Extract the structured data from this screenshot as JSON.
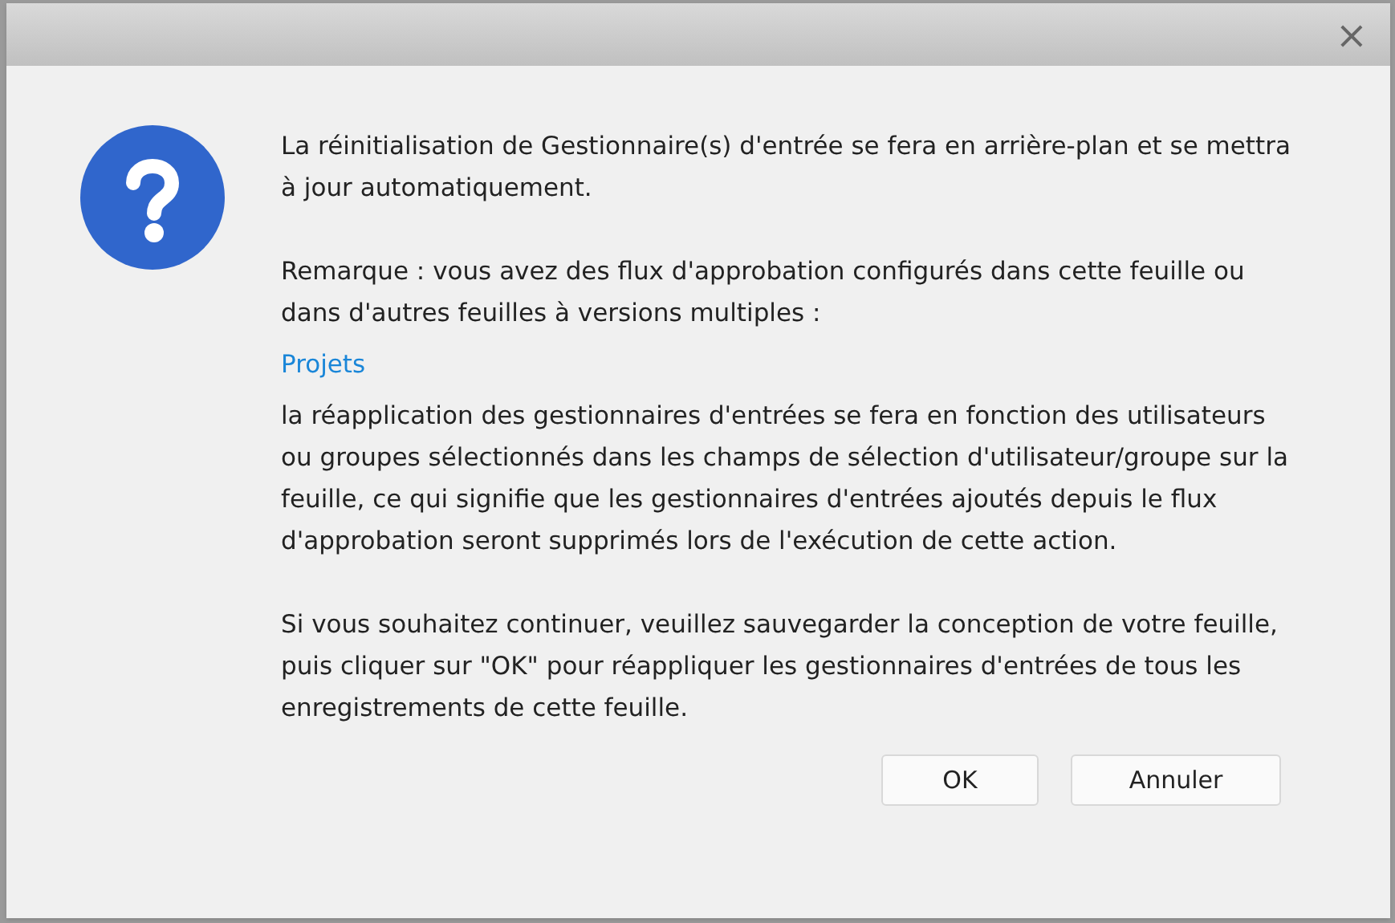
{
  "dialog": {
    "close_label": "×",
    "paragraphs": [
      {
        "kind": "text",
        "text": "La réinitialisation de Gestionnaire(s) d'entrée se fera en arrière-plan et se mettra à jour automatiquement."
      },
      {
        "kind": "text",
        "text": "Remarque : vous avez des flux d'approbation configurés dans cette feuille ou dans d'autres feuilles à versions multiples :"
      },
      {
        "kind": "link",
        "text": "Projets"
      },
      {
        "kind": "text",
        "text": "la réapplication des gestionnaires d'entrées se fera en fonction des utilisateurs ou groupes sélectionnés dans les champs de sélection d'utilisateur/groupe sur la feuille, ce qui signifie que les gestionnaires d'entrées ajoutés depuis le flux d'approbation seront supprimés lors de l'exécution de cette action."
      },
      {
        "kind": "text",
        "text": "Si vous souhaitez continuer, veuillez sauvegarder la conception de votre feuille, puis cliquer sur \"OK\" pour réappliquer les gestionnaires d'entrées de tous les enregistrements de cette feuille."
      }
    ],
    "buttons": [
      "OK",
      "Annuler"
    ]
  }
}
